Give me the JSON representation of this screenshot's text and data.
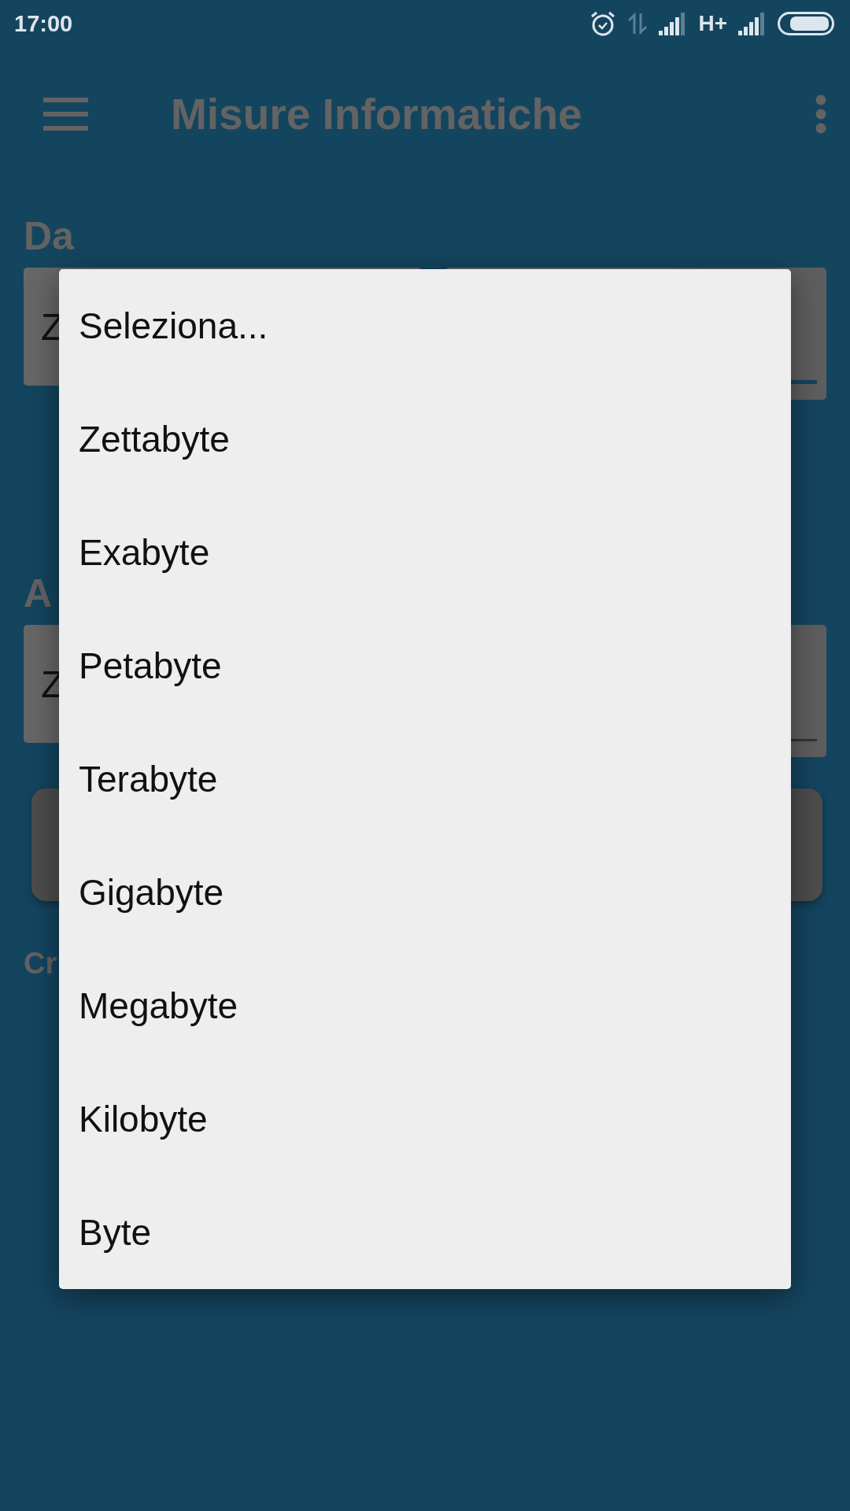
{
  "status_bar": {
    "time": "17:00",
    "network": "H+"
  },
  "toolbar": {
    "title": "Misure Informatiche"
  },
  "sections": [
    {
      "label": "Da",
      "unit": "Z",
      "input": {
        "focused": true
      }
    },
    {
      "label": "A",
      "unit": "Z",
      "input": {
        "focused": false
      }
    }
  ],
  "footer_label": "Cr",
  "dropdown": {
    "items": [
      {
        "label": "Seleziona...",
        "selected": false
      },
      {
        "label": "Zettabyte",
        "selected": false
      },
      {
        "label": "Exabyte",
        "selected": false
      },
      {
        "label": "Petabyte",
        "selected": false
      },
      {
        "label": "Terabyte",
        "selected": false
      },
      {
        "label": "Gigabyte",
        "selected": false
      },
      {
        "label": "Megabyte",
        "selected": false
      },
      {
        "label": "Kilobyte",
        "selected": false
      },
      {
        "label": "Byte",
        "selected": false
      }
    ]
  }
}
